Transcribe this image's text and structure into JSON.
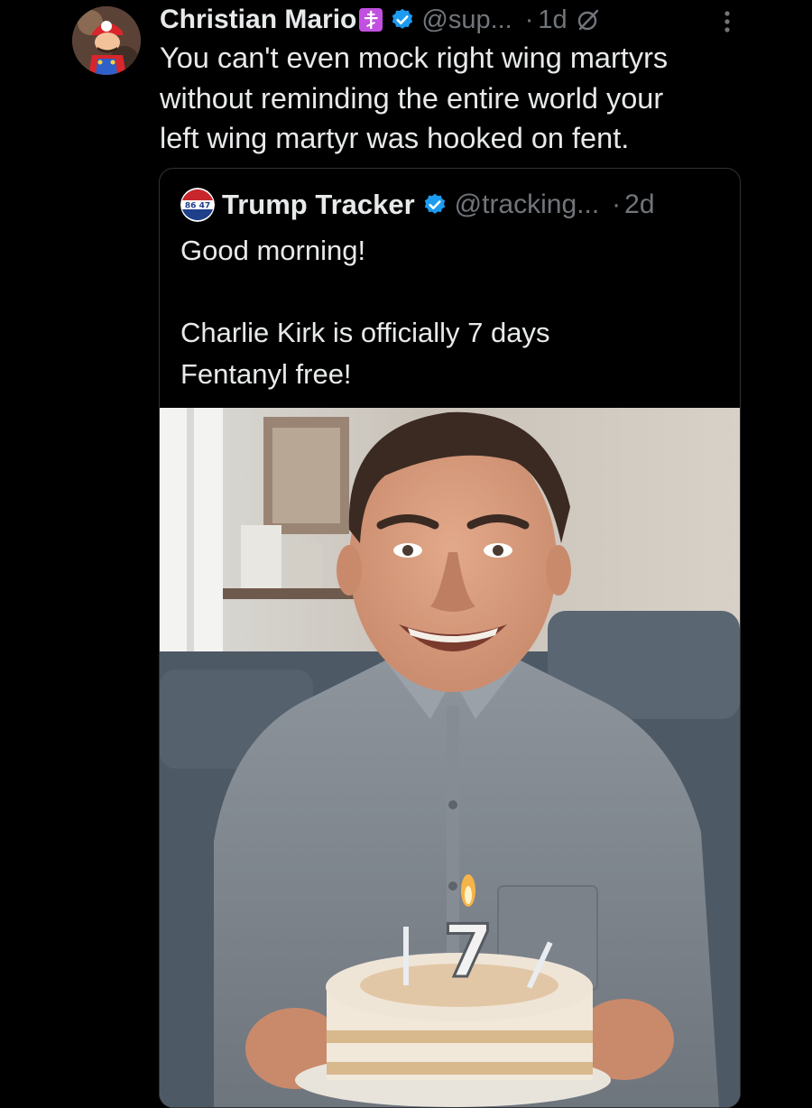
{
  "post": {
    "author": {
      "display_name": "Christian Mario",
      "badge_symbol": "☦",
      "verified": true,
      "handle": "@sup...",
      "avatar_icon": "mario-avatar"
    },
    "separator": "·",
    "timestamp": "1d",
    "text": "You can't even mock right wing martyrs\nwithout reminding the entire world your\nleft wing martyr was hooked on fent."
  },
  "quoted_post": {
    "author": {
      "display_name": "Trump Tracker",
      "verified": true,
      "handle": "@tracking...",
      "avatar_text": "86 47"
    },
    "separator": "·",
    "timestamp": "2d",
    "text": "Good morning!\n\nCharlie Kirk is officially 7 days\nFentanyl free!",
    "image": {
      "cake_number": "7"
    }
  },
  "colors": {
    "background": "#000000",
    "text_primary": "#e7e9ea",
    "text_secondary": "#71767b",
    "verified_blue": "#1d9bf0",
    "badge_purple": "#c150e0",
    "border": "#2f3336"
  },
  "icons": {
    "verified": "verified-badge-icon",
    "grok": "grok-icon",
    "more": "more-options-icon"
  }
}
